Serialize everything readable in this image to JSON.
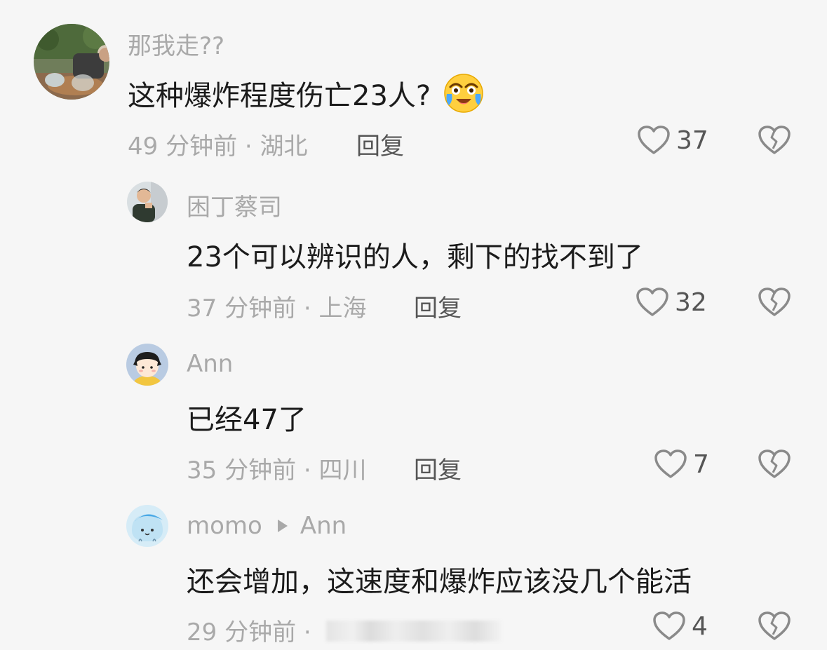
{
  "comments": [
    {
      "username": "那我走??",
      "content": "这种爆炸程度伤亡23人?",
      "emoji": "crying-laughing-emoji",
      "time": "49 分钟前",
      "location": "湖北",
      "reply_label": "回复",
      "likes": "37"
    },
    {
      "username": "困丁蔡司",
      "content": "23个可以辨识的人，剩下的找不到了",
      "time": "37 分钟前",
      "location": "上海",
      "reply_label": "回复",
      "likes": "32"
    },
    {
      "username": "Ann",
      "content": "已经47了",
      "time": "35 分钟前",
      "location": "四川",
      "reply_label": "回复",
      "likes": "7"
    },
    {
      "username": "momo",
      "reply_to": "Ann",
      "content": "还会增加，这速度和爆炸应该没几个能活",
      "time": "29 分钟前",
      "likes": "4"
    }
  ],
  "separator": "·",
  "colors": {
    "background": "#f6f6f6",
    "text_primary": "#1b1b1b",
    "text_secondary": "#a9a9a9",
    "reply": "#555555"
  }
}
